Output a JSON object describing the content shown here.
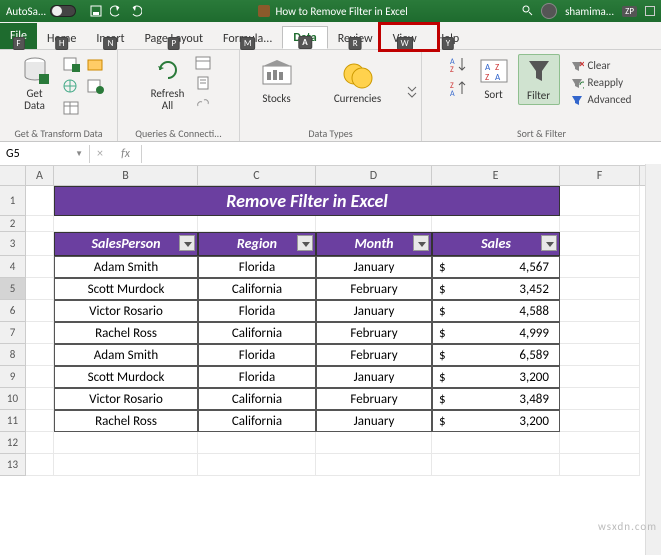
{
  "titlebar": {
    "autosave_label": "AutoSa...",
    "doc_title": "How to Remove Filter in Excel",
    "user": "shamima...",
    "user_keytip": "ZP"
  },
  "tabs": {
    "file": {
      "label": "File",
      "keytip": "F"
    },
    "home": {
      "label": "Home",
      "keytip": "H"
    },
    "insert": {
      "label": "Insert",
      "keytip": "N"
    },
    "page_layout": {
      "label": "Page Layout",
      "keytip": "P"
    },
    "formulas": {
      "label": "Formula...",
      "keytip": "M"
    },
    "data": {
      "label": "Data",
      "keytip": "A"
    },
    "review": {
      "label": "Review",
      "keytip": "R"
    },
    "view": {
      "label": "View",
      "keytip": "W"
    },
    "help": {
      "label": "Help",
      "keytip": "Y"
    }
  },
  "ribbon": {
    "get_data": "Get\nData",
    "group1": "Get & Transform Data",
    "refresh": "Refresh\nAll",
    "group2": "Queries & Connecti...",
    "stocks": "Stocks",
    "currencies": "Currencies",
    "group3": "Data Types",
    "sort": "Sort",
    "filter": "Filter",
    "clear": "Clear",
    "reapply": "Reapply",
    "advanced": "Advanced",
    "group4": "Sort & Filter"
  },
  "namebox": "G5",
  "fx": "fx",
  "cols": {
    "A": "A",
    "B": "B",
    "C": "C",
    "D": "D",
    "E": "E",
    "F": "F"
  },
  "banner": "Remove Filter in Excel",
  "headers": {
    "person": "SalesPerson",
    "region": "Region",
    "month": "Month",
    "sales": "Sales"
  },
  "rows": [
    {
      "p": "Adam Smith",
      "r": "Florida",
      "m": "January",
      "cur": "$",
      "s": "4,567"
    },
    {
      "p": "Scott Murdock",
      "r": "California",
      "m": "February",
      "cur": "$",
      "s": "3,452"
    },
    {
      "p": "Victor Rosario",
      "r": "Florida",
      "m": "January",
      "cur": "$",
      "s": "4,588"
    },
    {
      "p": "Rachel Ross",
      "r": "California",
      "m": "February",
      "cur": "$",
      "s": "4,999"
    },
    {
      "p": "Adam Smith",
      "r": "Florida",
      "m": "February",
      "cur": "$",
      "s": "6,589"
    },
    {
      "p": "Scott Murdock",
      "r": "Florida",
      "m": "January",
      "cur": "$",
      "s": "3,200"
    },
    {
      "p": "Victor Rosario",
      "r": "California",
      "m": "February",
      "cur": "$",
      "s": "3,489"
    },
    {
      "p": "Rachel Ross",
      "r": "California",
      "m": "January",
      "cur": "$",
      "s": "3,200"
    }
  ],
  "rownums": [
    "1",
    "2",
    "3",
    "4",
    "5",
    "6",
    "7",
    "8",
    "9",
    "10",
    "11",
    "12",
    "13"
  ],
  "watermark": "wsxdn.com"
}
